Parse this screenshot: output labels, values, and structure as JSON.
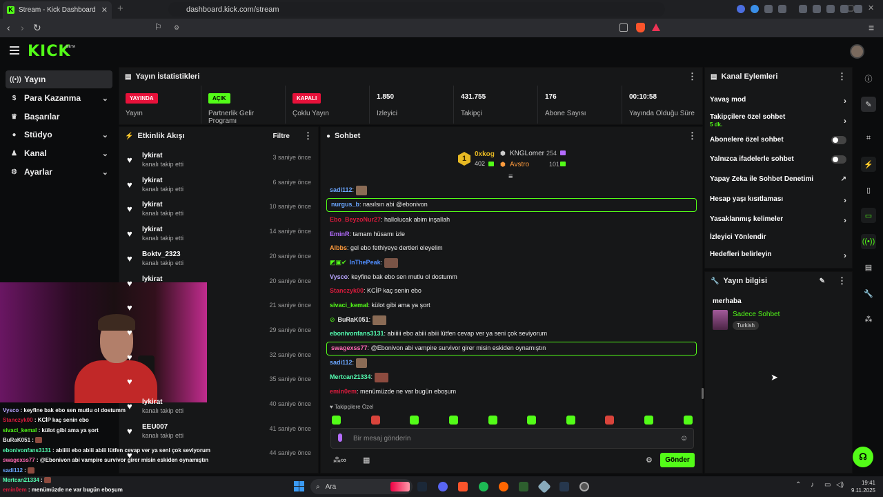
{
  "browser": {
    "tab_title": "Stream - Kick Dashboard",
    "url": "dashboard.kick.com/stream",
    "new_tab": "+"
  },
  "header": {
    "logo": "KICK",
    "beta": "BETA"
  },
  "sidebar": {
    "items": [
      {
        "label": "Yayın",
        "icon": "broadcast-icon",
        "active": true
      },
      {
        "label": "Para Kazanma",
        "icon": "dollar-icon",
        "expand": true
      },
      {
        "label": "Başarılar",
        "icon": "trophy-icon"
      },
      {
        "label": "Stüdyo",
        "icon": "studio-icon",
        "expand": true
      },
      {
        "label": "Kanal",
        "icon": "user-icon",
        "expand": true
      },
      {
        "label": "Ayarlar",
        "icon": "gear-icon",
        "expand": true
      }
    ]
  },
  "stats": {
    "title": "Yayın İstatistikleri",
    "cells": [
      {
        "badge": "YAYINDA",
        "label": "Yayın"
      },
      {
        "badge": "AÇIK",
        "label": "Partnerlik Gelir Programı"
      },
      {
        "badge": "KAPALI",
        "label": "Çoklu Yayın"
      },
      {
        "value": "1.850",
        "label": "İzleyici"
      },
      {
        "value": "431.755",
        "label": "Takipçi"
      },
      {
        "value": "176",
        "label": "Abone Sayısı"
      },
      {
        "value": "00:10:58",
        "label": "Yayında Olduğu Süre"
      }
    ]
  },
  "activity": {
    "title": "Etkinlik Akışı",
    "filter": "Filtre",
    "rows": [
      {
        "name": "lykirat",
        "sub": "kanalı takip etti",
        "time": "3 saniye önce"
      },
      {
        "name": "lykirat",
        "sub": "kanalı takip etti",
        "time": "6 saniye önce"
      },
      {
        "name": "lykirat",
        "sub": "kanalı takip etti",
        "time": "10 saniye önce"
      },
      {
        "name": "lykirat",
        "sub": "kanalı takip etti",
        "time": "14 saniye önce"
      },
      {
        "name": "Boktv_2323",
        "sub": "kanalı takip etti",
        "time": "20 saniye önce"
      },
      {
        "name": "lykirat",
        "sub": "",
        "time": "20 saniye önce"
      },
      {
        "name": "",
        "sub": "",
        "time": "21 saniye önce"
      },
      {
        "name": "",
        "sub": "",
        "time": "29 saniye önce"
      },
      {
        "name": "",
        "sub": "",
        "time": "32 saniye önce"
      },
      {
        "name": "",
        "sub": "",
        "time": "35 saniye önce"
      },
      {
        "name": "lykirat",
        "sub": "kanalı takip etti",
        "time": "40 saniye önce"
      },
      {
        "name": "EEU007",
        "sub": "kanalı takip etti",
        "time": "41 saniye önce"
      },
      {
        "name": "",
        "sub": "",
        "time": "44 saniye önce"
      }
    ]
  },
  "chat": {
    "title": "Sohbet",
    "leaderboard": {
      "rank": "1",
      "first": {
        "name": "0xkog",
        "value": "402"
      },
      "second": {
        "name": "KNGLomer",
        "value": "254"
      },
      "third": {
        "name": "Avstro",
        "value": "101"
      }
    },
    "messages": [
      {
        "user": "sadi112",
        "color": "#6aa6ff",
        "text": "",
        "emote": true
      },
      {
        "user": "nurgus_b",
        "color": "#6aa6ff",
        "text": "nasılsın abi @ebonivon",
        "highlight": true
      },
      {
        "user": "Ebo_BeyzoNur27",
        "color": "#d81b3c",
        "text": "hallolucak abim inşallah"
      },
      {
        "user": "EminR",
        "color": "#b56cff",
        "text": "tamam hüsamı izle"
      },
      {
        "user": "Albbs",
        "color": "#ff9b3d",
        "text": "gel ebo fethiyeye dertleri eleyelim"
      },
      {
        "user": "InThePeak",
        "color": "#4f8dff",
        "text": "",
        "emote": true,
        "badges": true
      },
      {
        "user": "Vysco",
        "color": "#b9a6ff",
        "text": "keyfine bak ebo sen mutlu ol dostumm"
      },
      {
        "user": "Stanczyk00",
        "color": "#d81b3c",
        "text": "KCİP kaç senin ebo"
      },
      {
        "user": "sivaci_kemal",
        "color": "#53fc18",
        "text": "külot gibi ama ya şort"
      },
      {
        "user": "BuRaK051",
        "color": "#e8e8e8",
        "text": "",
        "emote": true,
        "badges": true
      },
      {
        "user": "ebonivonfans3131",
        "color": "#53fcb0",
        "text": "abiiiii ebo abiii abiii lütfen cevap ver ya seni çok seviyorum"
      },
      {
        "user": "swagexss77",
        "color": "#ff6bb4",
        "text": "@Ebonivon abi vampire survivor girer misin eskiden oynamıştın",
        "highlight": true
      },
      {
        "user": "sadi112",
        "color": "#6aa6ff",
        "text": "",
        "emote": true
      },
      {
        "user": "Mertcan21334",
        "color": "#53fcb0",
        "text": "",
        "emote": true
      },
      {
        "user": "emin0em",
        "color": "#d81b3c",
        "text": "menümüzde ne var bugün eboşum"
      }
    ],
    "followers_only": "Takipçilere Özel",
    "input_placeholder": "Bir mesaj gönderin",
    "send": "Gönder"
  },
  "channel_actions": {
    "title": "Kanal Eylemleri",
    "items": [
      {
        "label": "Yavaş mod",
        "type": "arrow"
      },
      {
        "label": "Takipçilere özel sohbet",
        "sub": "5 dk.",
        "type": "arrow"
      },
      {
        "label": "Abonelere özel sohbet",
        "type": "toggle"
      },
      {
        "label": "Yalnızca ifadelerle sohbet",
        "type": "toggle"
      },
      {
        "label": "Yapay Zeka ile Sohbet Denetimi",
        "type": "ext"
      },
      {
        "label": "Hesap yaşı kısıtlaması",
        "type": "arrow"
      },
      {
        "label": "Yasaklanmış kelimeler",
        "type": "arrow"
      },
      {
        "label": "İzleyici Yönlendir",
        "type": "none"
      },
      {
        "label": "Hedefleri belirleyin",
        "type": "arrow"
      }
    ]
  },
  "stream_info": {
    "title": "Yayın bilgisi",
    "stream_title": "merhaba",
    "category": "Sadece Sohbet",
    "tag": "Turkish"
  },
  "overlay_chat": [
    {
      "user": "Vysco",
      "color": "#b9a6ff",
      "text": "keyfine bak ebo sen mutlu ol dostumm"
    },
    {
      "user": "Stanczyk00",
      "color": "#d81b3c",
      "text": "KCİP kaç senin ebo"
    },
    {
      "user": "sivaci_kemal",
      "color": "#53fc18",
      "text": "külot gibi ama ya şort"
    },
    {
      "user": "BuRaK051",
      "color": "#e8e8e8",
      "text": ""
    },
    {
      "user": "ebonivonfans3131",
      "color": "#53fcb0",
      "text": "abiiiii ebo abiii abiii lütfen cevap ver ya seni çok seviyorum"
    },
    {
      "user": "swagexss77",
      "color": "#ff6bb4",
      "text": "@Ebonivon abi vampire survivor girer misin eskiden oynamıştın"
    },
    {
      "user": "sadi112",
      "color": "#6aa6ff",
      "text": ""
    },
    {
      "user": "Mertcan21334",
      "color": "#53fcb0",
      "text": ""
    },
    {
      "user": "emin0em",
      "color": "#d81b3c",
      "text": "menümüzde ne var bugün eboşum"
    }
  ],
  "taskbar": {
    "search": "Ara",
    "time": "19:41",
    "date": "9.11.2025"
  },
  "colors": {
    "accent": "#53fc18",
    "live": "#e8113a",
    "bg": "#0b0c0d",
    "panel": "#161718"
  }
}
